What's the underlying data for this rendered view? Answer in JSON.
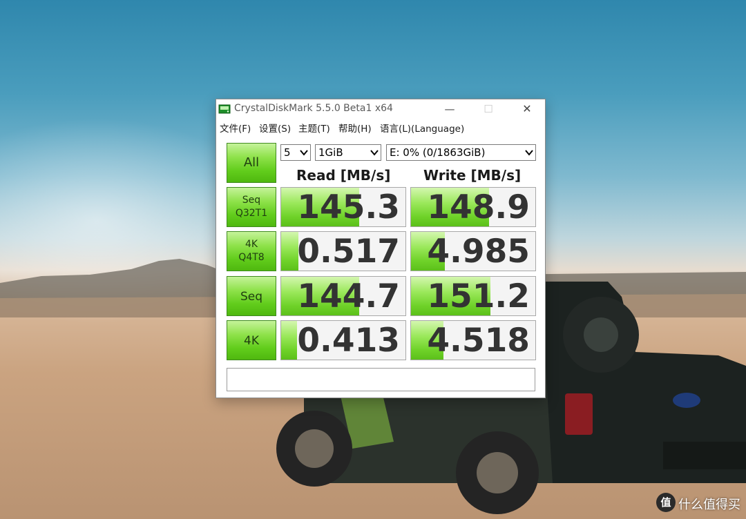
{
  "window": {
    "title": "CrystalDiskMark 5.5.0 Beta1 x64",
    "min_glyph": "—",
    "max_glyph": "☐",
    "close_glyph": "✕"
  },
  "menu": [
    "文件(F)",
    "设置(S)",
    "主题(T)",
    "帮助(H)",
    "语言(L)(Language)"
  ],
  "controls": {
    "all_label": "All",
    "count": "5",
    "size": "1GiB",
    "drive": "E: 0% (0/1863GiB)"
  },
  "headers": {
    "read": "Read [MB/s]",
    "write": "Write [MB/s]"
  },
  "tests": [
    {
      "label_line1": "Seq",
      "label_line2": "Q32T1",
      "read": "145.3",
      "write": "148.9",
      "read_fill": 0.63,
      "write_fill": 0.63
    },
    {
      "label_line1": "4K",
      "label_line2": "Q4T8",
      "read": "0.517",
      "write": "4.985",
      "read_fill": 0.14,
      "write_fill": 0.27
    },
    {
      "label_line1": "Seq",
      "label_line2": "",
      "read": "144.7",
      "write": "151.2",
      "read_fill": 0.63,
      "write_fill": 0.64
    },
    {
      "label_line1": "4K",
      "label_line2": "",
      "read": "0.413",
      "write": "4.518",
      "read_fill": 0.13,
      "write_fill": 0.26
    }
  ],
  "comment": "",
  "watermark": {
    "logo": "值",
    "text": "什么值得买"
  },
  "colors": {
    "accent_green": "#62cd1c",
    "value_text": "#333333"
  }
}
